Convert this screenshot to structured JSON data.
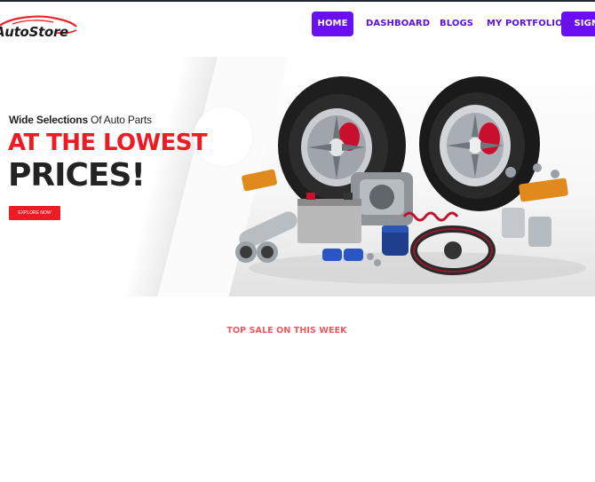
{
  "brand": {
    "name_part1": "Auto",
    "name_part2": "Store",
    "logo_color": "#e8262b"
  },
  "nav": {
    "items": [
      {
        "label": "HOME",
        "active": true
      },
      {
        "label": "DASHBOARD",
        "active": false
      },
      {
        "label": "BLOGS",
        "active": false
      },
      {
        "label": "MY PORTFOLIO",
        "active": false
      }
    ],
    "signin_label": "SIGN O"
  },
  "hero": {
    "subtitle_bold": "Wide Selections",
    "subtitle_light": " Of Auto Parts",
    "headline": "AT THE LOWEST",
    "headline2": "PRICES!",
    "cta_label": "EXPLORE NOW",
    "image_alt": "auto-parts-collection"
  },
  "section": {
    "title": "TOP SALE ON THIS WEEK"
  },
  "colors": {
    "accent": "#6a10f0",
    "nav_text": "#5a10d8",
    "red": "#ed1c24",
    "section_title": "#f0575d"
  }
}
